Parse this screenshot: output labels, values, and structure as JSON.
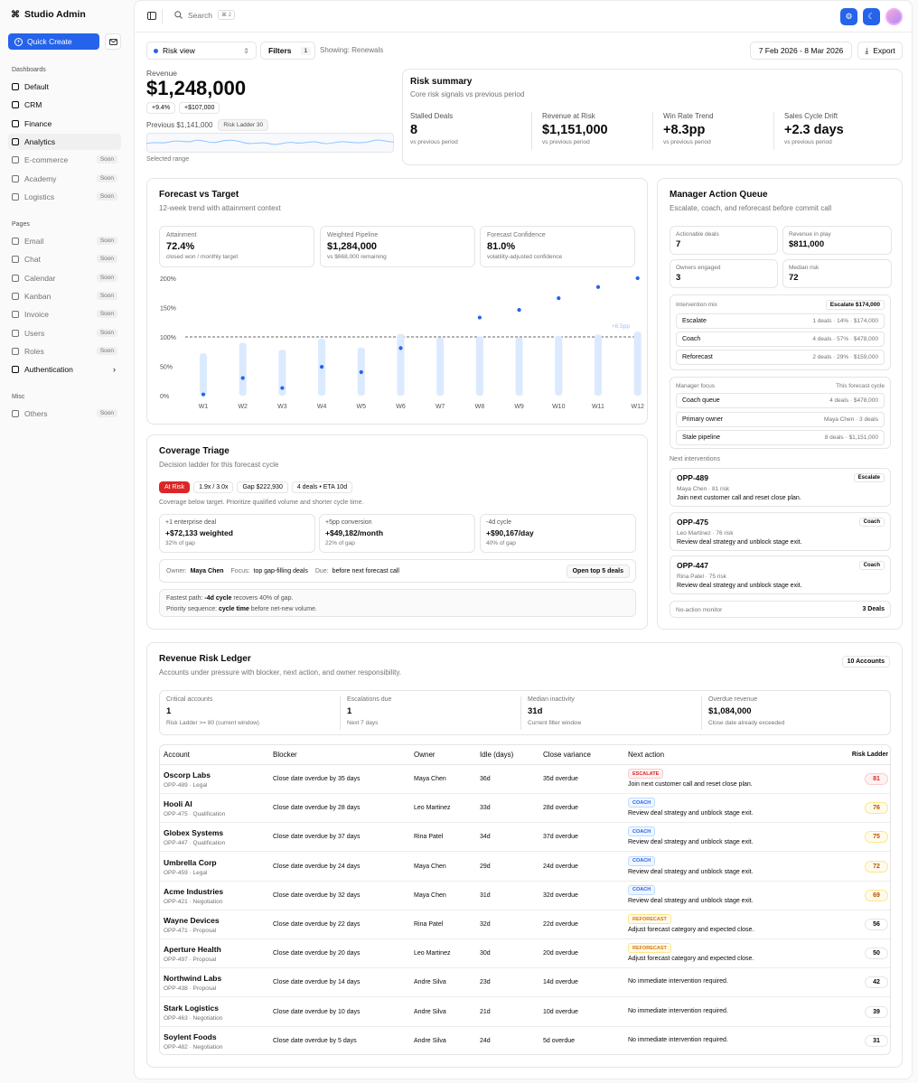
{
  "app": {
    "title": "Studio Admin"
  },
  "sidebar": {
    "quick_create": "Quick Create",
    "dashboards_label": "Dashboards",
    "dashboards": [
      {
        "label": "Default",
        "soon": ""
      },
      {
        "label": "CRM",
        "soon": ""
      },
      {
        "label": "Finance",
        "soon": ""
      },
      {
        "label": "Analytics",
        "soon": ""
      },
      {
        "label": "E-commerce",
        "soon": "Soon"
      },
      {
        "label": "Academy",
        "soon": "Soon"
      },
      {
        "label": "Logistics",
        "soon": "Soon"
      }
    ],
    "pages_label": "Pages",
    "pages": [
      {
        "label": "Email",
        "soon": "Soon"
      },
      {
        "label": "Chat",
        "soon": "Soon"
      },
      {
        "label": "Calendar",
        "soon": "Soon"
      },
      {
        "label": "Kanban",
        "soon": "Soon"
      },
      {
        "label": "Invoice",
        "soon": "Soon"
      },
      {
        "label": "Users",
        "soon": "Soon"
      },
      {
        "label": "Roles",
        "soon": "Soon"
      },
      {
        "label": "Authentication",
        "soon": ""
      }
    ],
    "misc_label": "Misc",
    "misc": [
      {
        "label": "Others",
        "soon": "Soon"
      }
    ]
  },
  "topbar": {
    "search_placeholder": "Search",
    "search_kbd": "⌘ J"
  },
  "toolbar": {
    "view": "Risk view",
    "filters": "Filters",
    "filter_count": "1",
    "showing": "Showing: Renewals",
    "date_range": "7 Feb 2026 - 8 Mar 2026",
    "export": "Export"
  },
  "revenue": {
    "label": "Revenue",
    "value": "$1,248,000",
    "delta_pct": "+9.4%",
    "delta_abs": "+$107,000",
    "previous": "Previous $1,141,000",
    "ladder": "Risk Ladder 30",
    "selected_range": "Selected range"
  },
  "risk_summary": {
    "title": "Risk summary",
    "subtitle": "Core risk signals vs previous period",
    "metrics": [
      {
        "label": "Stalled Deals",
        "value": "8",
        "note": "vs previous period"
      },
      {
        "label": "Revenue at Risk",
        "value": "$1,151,000",
        "note": "vs previous period"
      },
      {
        "label": "Win Rate Trend",
        "value": "+8.3pp",
        "note": "vs previous period"
      },
      {
        "label": "Sales Cycle Drift",
        "value": "+2.3 days",
        "note": "vs previous period"
      }
    ]
  },
  "forecast": {
    "title": "Forecast vs Target",
    "subtitle": "12-week trend with attainment context",
    "kpis": [
      {
        "label": "Attainment",
        "value": "72.4%",
        "note": "closed won / monthly target"
      },
      {
        "label": "Weighted Pipeline",
        "value": "$1,284,000",
        "note": "vs $668,000 remaining"
      },
      {
        "label": "Forecast Confidence",
        "value": "81.0%",
        "note": "volatility-adjusted confidence"
      }
    ],
    "target_label": "+8.5pp"
  },
  "chart_data": {
    "type": "bar",
    "categories": [
      "W1",
      "W2",
      "W3",
      "W4",
      "W5",
      "W6",
      "W7",
      "W8",
      "W9",
      "W10",
      "W11",
      "W12"
    ],
    "yticks": [
      "0%",
      "50%",
      "100%",
      "150%",
      "200%"
    ],
    "ylim": [
      0,
      200
    ],
    "target": 100,
    "series": [
      {
        "values": [
          72,
          90,
          78,
          97,
          82,
          105,
          99,
          101,
          99,
          102,
          104,
          109
        ]
      },
      {
        "values": [
          2,
          30,
          13,
          49,
          40,
          81,
          null,
          133,
          146,
          166,
          185,
          200
        ]
      }
    ]
  },
  "coverage": {
    "title": "Coverage Triage",
    "subtitle": "Decision ladder for this forecast cycle",
    "chips": [
      "At Risk",
      "1.9x / 3.0x",
      "Gap $222,930",
      "4 deals • ETA 10d"
    ],
    "note": "Coverage below target. Prioritize qualified volume and shorter cycle time.",
    "levers": [
      {
        "label": "+1 enterprise deal",
        "value": "+$72,133 weighted",
        "note": "32% of gap"
      },
      {
        "label": "+5pp conversion",
        "value": "+$49,182/month",
        "note": "22% of gap"
      },
      {
        "label": "-4d cycle",
        "value": "+$90,167/day",
        "note": "40% of gap"
      }
    ],
    "owner_label": "Owner:",
    "owner": "Maya Chen",
    "focus_label": "Focus:",
    "focus": "top gap-filling deals",
    "due_label": "Due:",
    "due": "before next forecast call",
    "open_btn": "Open top 5 deals",
    "fastest_label": "Fastest path:",
    "fastest_bold": "-4d cycle",
    "fastest_rest": "recovers 40% of gap.",
    "priority_label": "Priority sequence:",
    "priority_bold": "cycle time",
    "priority_rest": "before net-new volume."
  },
  "manager": {
    "title": "Manager Action Queue",
    "subtitle": "Escalate, coach, and reforecast before commit call",
    "stats": [
      {
        "label": "Actionable deals",
        "value": "7"
      },
      {
        "label": "Revenue in play",
        "value": "$811,000"
      },
      {
        "label": "Owners engaged",
        "value": "3"
      },
      {
        "label": "Median risk",
        "value": "72"
      }
    ],
    "mix_label": "Intervention mix",
    "mix_badge": "Escalate $174,000",
    "mix": [
      {
        "name": "Escalate",
        "meta": "1 deals · 14% · $174,000"
      },
      {
        "name": "Coach",
        "meta": "4 deals · 57% · $478,000"
      },
      {
        "name": "Reforecast",
        "meta": "2 deals · 29% · $159,000"
      }
    ],
    "focus_label": "Manager focus",
    "focus_right": "This forecast cycle",
    "focus": [
      {
        "name": "Coach queue",
        "meta": "4 deals · $478,000"
      },
      {
        "name": "Primary owner",
        "meta": "Maya Chen · 3 deals"
      },
      {
        "name": "Stale pipeline",
        "meta": "8 deals · $1,151,000"
      }
    ],
    "next_label": "Next interventions",
    "next": [
      {
        "id": "OPP-489",
        "action": "Escalate",
        "meta": "Maya Chen · 81 risk",
        "desc": "Join next customer call and reset close plan."
      },
      {
        "id": "OPP-475",
        "action": "Coach",
        "meta": "Leo Martinez · 76 risk",
        "desc": "Review deal strategy and unblock stage exit."
      },
      {
        "id": "OPP-447",
        "action": "Coach",
        "meta": "Rina Patel · 75 risk",
        "desc": "Review deal strategy and unblock stage exit."
      }
    ],
    "monitor_label": "No-action monitor",
    "monitor_value": "3 Deals"
  },
  "ledger": {
    "title": "Revenue Risk Ledger",
    "subtitle": "Accounts under pressure with blocker, next action, and owner responsibility.",
    "count": "10 Accounts",
    "summary": [
      {
        "label": "Critical accounts",
        "value": "1",
        "note": "Risk Ladder >= 80 (current window)"
      },
      {
        "label": "Escalations due",
        "value": "1",
        "note": "Next 7 days"
      },
      {
        "label": "Median inactivity",
        "value": "31d",
        "note": "Current filter window"
      },
      {
        "label": "Overdue revenue",
        "value": "$1,084,000",
        "note": "Close date already exceeded"
      }
    ],
    "columns": [
      "Account",
      "Blocker",
      "Owner",
      "Idle (days)",
      "Close variance",
      "Next action",
      "Risk Ladder"
    ],
    "rows": [
      {
        "account": "Oscorp Labs",
        "sub": "OPP-489 · Legal",
        "blocker": "Close date overdue by 35 days",
        "owner": "Maya Chen",
        "idle": "36d",
        "variance": "35d overdue",
        "badge": "ESCALATE",
        "action": "Join next customer call and reset close plan.",
        "risk": "81",
        "tone": "r"
      },
      {
        "account": "Hooli AI",
        "sub": "OPP-475 · Qualification",
        "blocker": "Close date overdue by 28 days",
        "owner": "Leo Martinez",
        "idle": "33d",
        "variance": "28d overdue",
        "badge": "COACH",
        "action": "Review deal strategy and unblock stage exit.",
        "risk": "76",
        "tone": "a"
      },
      {
        "account": "Globex Systems",
        "sub": "OPP-447 · Qualification",
        "blocker": "Close date overdue by 37 days",
        "owner": "Rina Patel",
        "idle": "34d",
        "variance": "37d overdue",
        "badge": "COACH",
        "action": "Review deal strategy and unblock stage exit.",
        "risk": "75",
        "tone": "a"
      },
      {
        "account": "Umbrella Corp",
        "sub": "OPP-459 · Legal",
        "blocker": "Close date overdue by 24 days",
        "owner": "Maya Chen",
        "idle": "29d",
        "variance": "24d overdue",
        "badge": "COACH",
        "action": "Review deal strategy and unblock stage exit.",
        "risk": "72",
        "tone": "a"
      },
      {
        "account": "Acme Industries",
        "sub": "OPP-421 · Negotiation",
        "blocker": "Close date overdue by 32 days",
        "owner": "Maya Chen",
        "idle": "31d",
        "variance": "32d overdue",
        "badge": "COACH",
        "action": "Review deal strategy and unblock stage exit.",
        "risk": "69",
        "tone": "a"
      },
      {
        "account": "Wayne Devices",
        "sub": "OPP-471 · Proposal",
        "blocker": "Close date overdue by 22 days",
        "owner": "Rina Patel",
        "idle": "32d",
        "variance": "22d overdue",
        "badge": "REFORECAST",
        "action": "Adjust forecast category and expected close.",
        "risk": "56",
        "tone": "n"
      },
      {
        "account": "Aperture Health",
        "sub": "OPP-497 · Proposal",
        "blocker": "Close date overdue by 20 days",
        "owner": "Leo Martinez",
        "idle": "30d",
        "variance": "20d overdue",
        "badge": "REFORECAST",
        "action": "Adjust forecast category and expected close.",
        "risk": "50",
        "tone": "n"
      },
      {
        "account": "Northwind Labs",
        "sub": "OPP-438 · Proposal",
        "blocker": "Close date overdue by 14 days",
        "owner": "Andre Silva",
        "idle": "23d",
        "variance": "14d overdue",
        "badge": "",
        "action": "No immediate intervention required.",
        "risk": "42",
        "tone": "n"
      },
      {
        "account": "Stark Logistics",
        "sub": "OPP-463 · Negotiation",
        "blocker": "Close date overdue by 10 days",
        "owner": "Andre Silva",
        "idle": "21d",
        "variance": "10d overdue",
        "badge": "",
        "action": "No immediate intervention required.",
        "risk": "39",
        "tone": "n"
      },
      {
        "account": "Soylent Foods",
        "sub": "OPP-482 · Negotiation",
        "blocker": "Close date overdue by 5 days",
        "owner": "Andre Silva",
        "idle": "24d",
        "variance": "5d overdue",
        "badge": "",
        "action": "No immediate intervention required.",
        "risk": "31",
        "tone": "n"
      }
    ]
  },
  "colors": {
    "accent": "#2563eb",
    "bar": "#dbeafe",
    "danger": "#dc2626"
  }
}
